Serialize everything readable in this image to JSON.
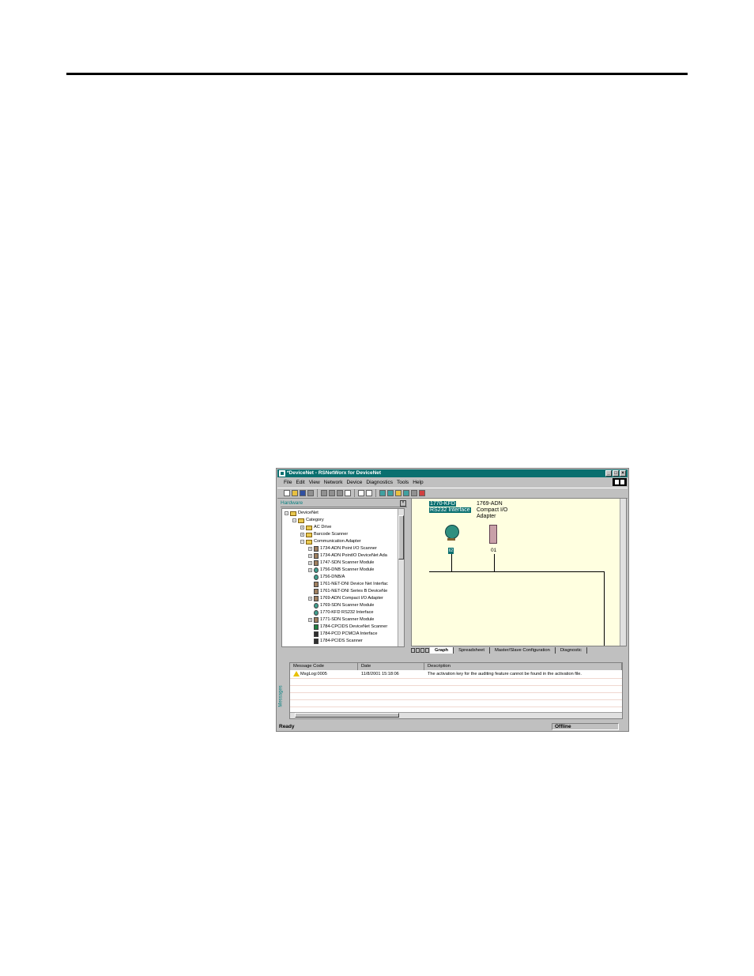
{
  "window": {
    "title": "*DeviceNet - RSNetWorx for DeviceNet"
  },
  "menu": [
    "File",
    "Edit",
    "View",
    "Network",
    "Device",
    "Diagnostics",
    "Tools",
    "Help"
  ],
  "hardware_panel": {
    "title": "Hardware",
    "root": "DeviceNet",
    "category": "Category",
    "items": [
      "AC Drive",
      "Barcode Scanner",
      "Communication Adapter",
      "1734-ADN Point I/O Scanner",
      "1734-ADN PointIO DeviceNet Ada",
      "1747-SDN Scanner Module",
      "1756-DNB Scanner Module",
      "1756-DNB/A",
      "1761-NET-DNI Device Net Interfac",
      "1761-NET-DNI Series B DeviceNe",
      "1769-ADN Compact I/O Adapter",
      "1769-SDN Scanner Module",
      "1770-KFD RS232 Interface",
      "1771-SDN Scanner Module",
      "1784-CPCIDS DeviceNet Scanner",
      "1784-PCD PCMCIA Interface",
      "1784-PCIDS Scanner"
    ]
  },
  "graph": {
    "device1_line1": "1770-KFD",
    "device1_line2": "RS232 Interface",
    "device1_addr": "62",
    "device2_line1": "1769-ADN",
    "device2_line2": "Compact I/O",
    "device2_line3": "Adapter",
    "device2_addr": "01"
  },
  "tabs": [
    "Graph",
    "Spreadsheet",
    "Master/Slave Configuration",
    "Diagnostic"
  ],
  "messages": {
    "side_label": "Messages",
    "columns": [
      "Message Code",
      "Date",
      "Description"
    ],
    "rows": [
      {
        "code": "MsgLog:0005",
        "date": "11/8/2001 15:18:06",
        "description": "The activation key for the auditing feature cannot be found in the activation file."
      }
    ]
  },
  "status": {
    "left": "Ready",
    "right": "Offline"
  },
  "colors": {
    "titlebar": "#0a6f6f",
    "graph_bg": "#ffffe0"
  }
}
